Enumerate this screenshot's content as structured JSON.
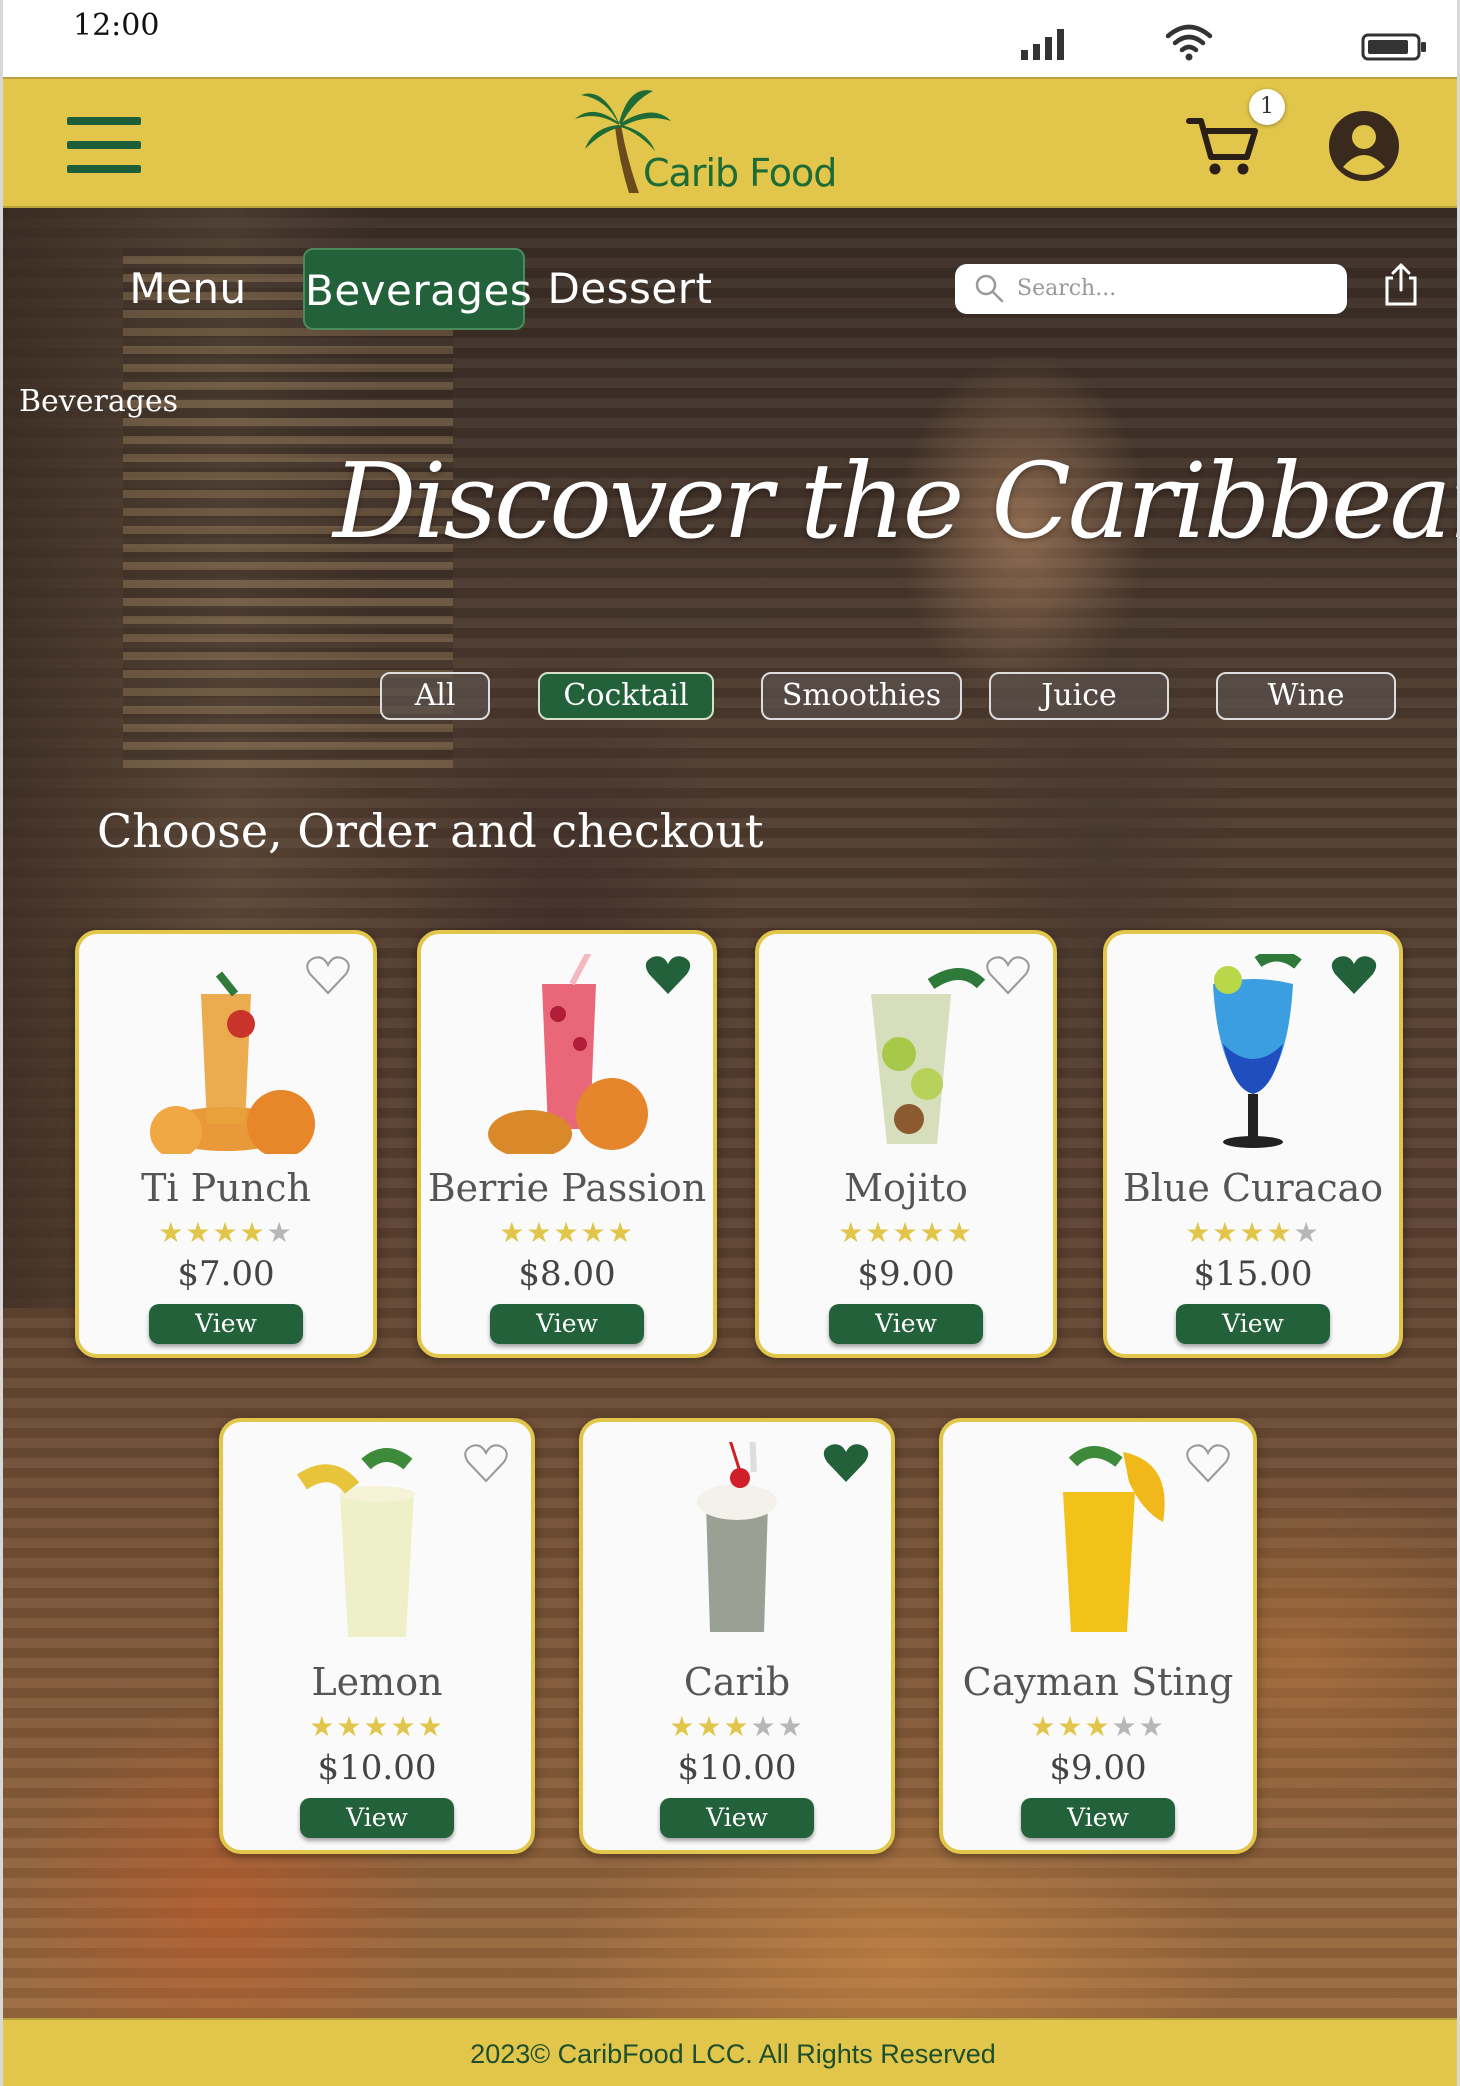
{
  "status_bar": {
    "time": "12:00",
    "icons": [
      "signal-icon",
      "wifi-icon",
      "battery-icon"
    ]
  },
  "header": {
    "logo_text": "Carib Food",
    "cart_count": "1",
    "icons": [
      "menu-icon",
      "palm-tree-icon",
      "cart-icon",
      "account-icon"
    ]
  },
  "nav": {
    "menu": "Menu",
    "beverages": "Beverages",
    "dessert": "Dessert",
    "active": "Beverages"
  },
  "search": {
    "placeholder": "Search..."
  },
  "breadcrumb": "Beverages",
  "hero_title": "Discover the Caribbean Flava",
  "filters": [
    "All",
    "Cocktail",
    "Smoothies",
    "Juice",
    "Wine"
  ],
  "active_filter": "Cocktail",
  "subtitle": "Choose, Order and checkout",
  "products": [
    {
      "name": "Ti Punch",
      "rating": 4,
      "price": "$7.00",
      "favorite": false,
      "button": "View"
    },
    {
      "name": "Berrie Passion",
      "rating": 5,
      "price": "$8.00",
      "favorite": true,
      "button": "View"
    },
    {
      "name": "Mojito",
      "rating": 5,
      "price": "$9.00",
      "favorite": false,
      "button": "View"
    },
    {
      "name": "Blue Curacao",
      "rating": 4,
      "price": "$15.00",
      "favorite": true,
      "button": "View"
    },
    {
      "name": "Lemon",
      "rating": 5,
      "price": "$10.00",
      "favorite": false,
      "button": "View"
    },
    {
      "name": "Carib",
      "rating": 3,
      "price": "$10.00",
      "favorite": true,
      "button": "View"
    },
    {
      "name": "Cayman Sting",
      "rating": 3,
      "price": "$9.00",
      "favorite": false,
      "button": "View"
    }
  ],
  "footer": {
    "text": "2023© CaribFood LCC. All Rights Reserved"
  },
  "colors": {
    "brand_yellow": "#e2c64b",
    "brand_green": "#22613a",
    "star": "#e2c64b"
  }
}
